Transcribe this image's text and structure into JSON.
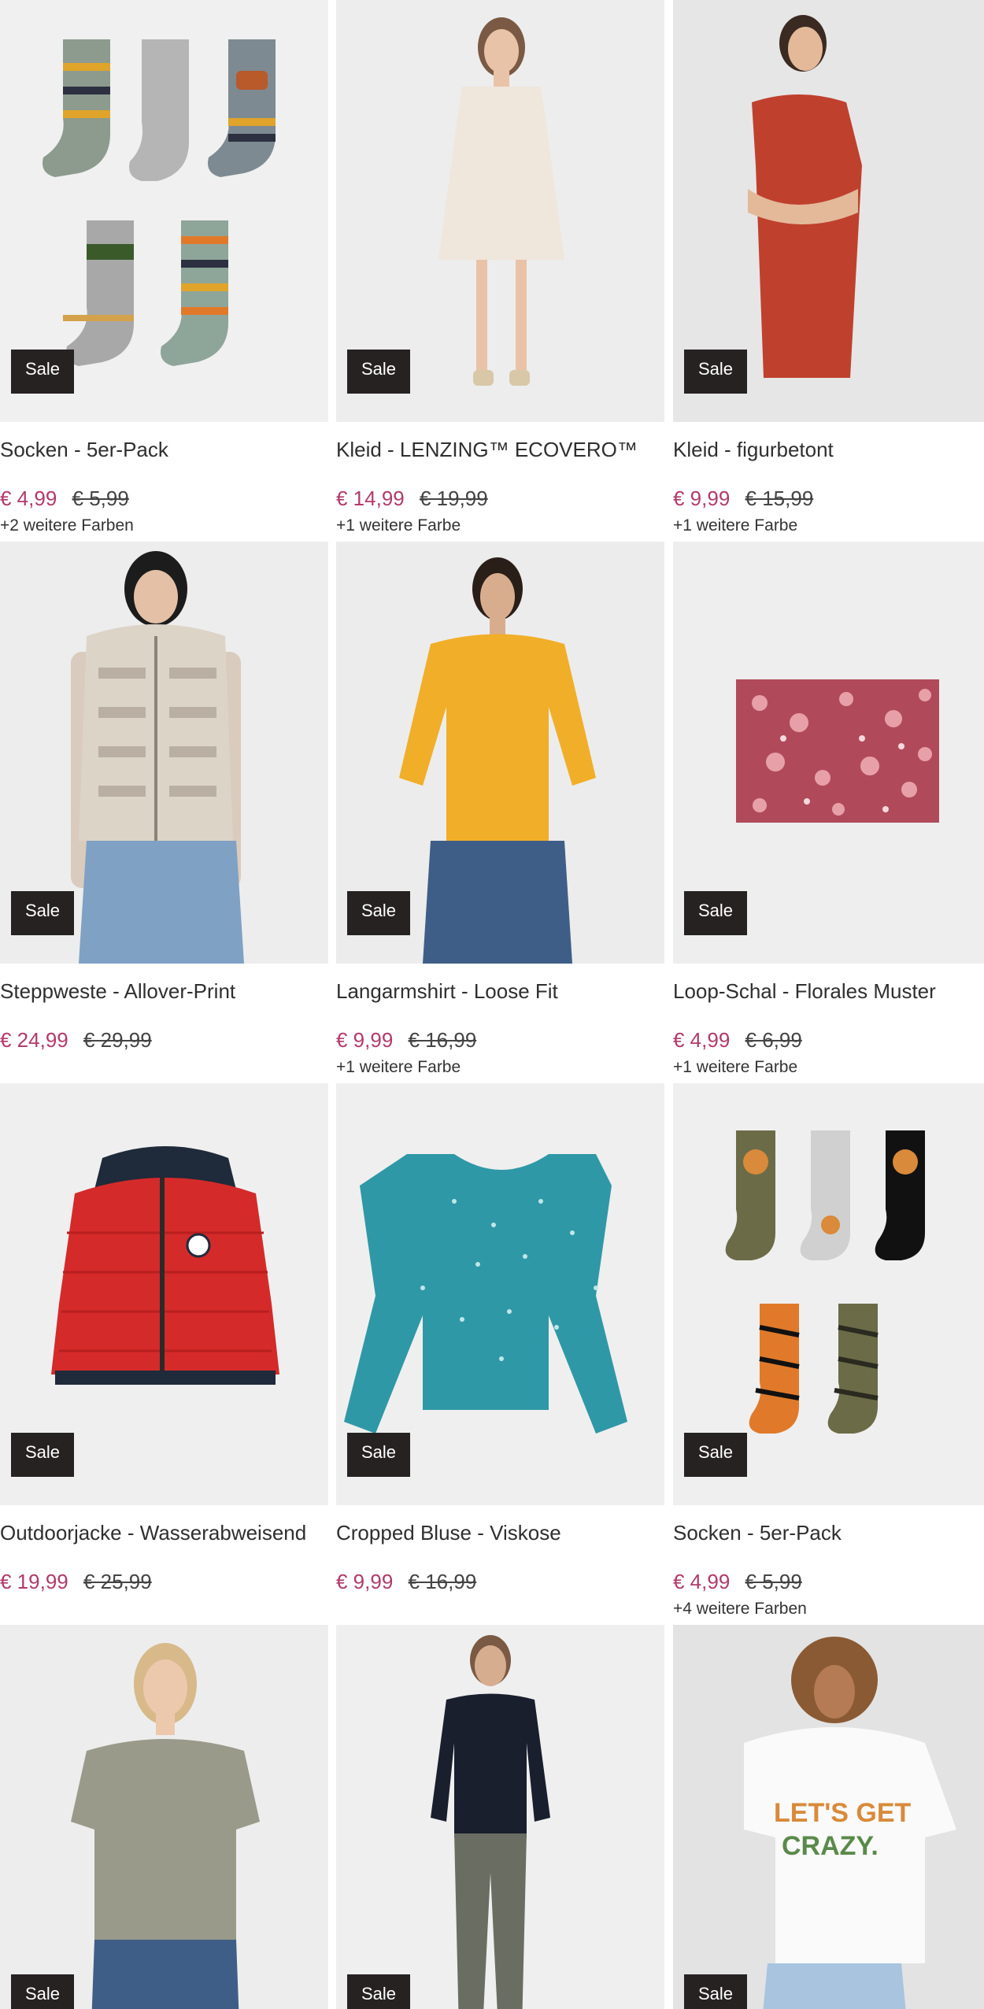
{
  "products": [
    {
      "badge": "Sale",
      "name": "Socken - 5er-Pack",
      "price": "€ 4,99",
      "old_price": "€ 5,99",
      "colors": "+2 weitere Farben",
      "image": "striped-socks"
    },
    {
      "badge": "Sale",
      "name": "Kleid - LENZING™ ECOVERO™",
      "price": "€ 14,99",
      "old_price": "€ 19,99",
      "colors": "+1 weitere Farbe",
      "image": "white-dress"
    },
    {
      "badge": "Sale",
      "name": "Kleid - figurbetont",
      "price": "€ 9,99",
      "old_price": "€ 15,99",
      "colors": "+1 weitere Farbe",
      "image": "red-dress"
    },
    {
      "badge": "Sale",
      "name": "Steppweste - Allover-Print",
      "price": "€ 24,99",
      "old_price": "€ 29,99",
      "colors": "",
      "image": "quilted-vest"
    },
    {
      "badge": "Sale",
      "name": "Langarmshirt - Loose Fit",
      "price": "€ 9,99",
      "old_price": "€ 16,99",
      "colors": "+1 weitere Farbe",
      "image": "yellow-shirt"
    },
    {
      "badge": "Sale",
      "name": "Loop-Schal - Florales Muster",
      "price": "€ 4,99",
      "old_price": "€ 6,99",
      "colors": "+1 weitere Farbe",
      "image": "floral-scarf"
    },
    {
      "badge": "Sale",
      "name": "Outdoorjacke - Wasserabweisend",
      "price": "€ 19,99",
      "old_price": "€ 25,99",
      "colors": "",
      "image": "red-jacket"
    },
    {
      "badge": "Sale",
      "name": "Cropped Bluse - Viskose",
      "price": "€ 9,99",
      "old_price": "€ 16,99",
      "colors": "",
      "image": "teal-blouse"
    },
    {
      "badge": "Sale",
      "name": "Socken - 5er-Pack",
      "price": "€ 4,99",
      "old_price": "€ 5,99",
      "colors": "+4 weitere Farben",
      "image": "tiger-socks"
    },
    {
      "badge": "Sale",
      "name": "",
      "price": "",
      "old_price": "",
      "colors": "",
      "image": "grey-tshirt"
    },
    {
      "badge": "Sale",
      "name": "",
      "price": "",
      "old_price": "",
      "colors": "",
      "image": "navy-sweater"
    },
    {
      "badge": "Sale",
      "name": "",
      "price": "",
      "old_price": "",
      "colors": "",
      "image": "white-print-tshirt"
    }
  ],
  "print_text_line1": "LET'S GET",
  "print_text_line2": "CRAZY."
}
